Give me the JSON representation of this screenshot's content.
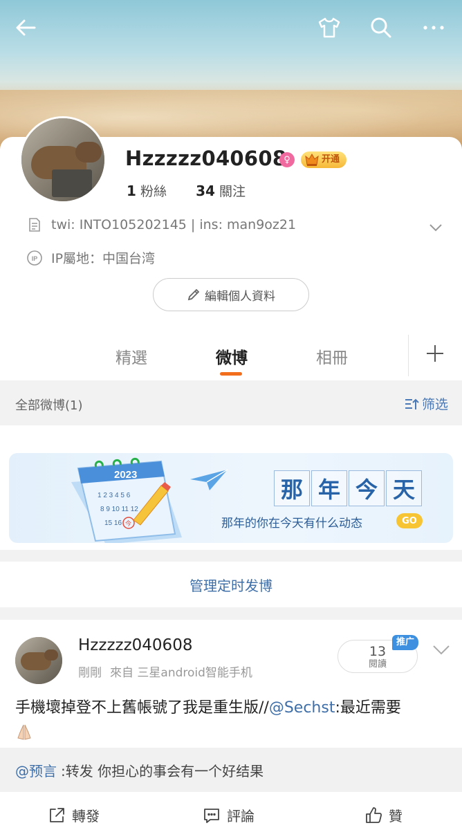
{
  "profile": {
    "username": "Hzzzzz040608",
    "gender_symbol": "♀",
    "vip_label": "开通",
    "followers_count": "1",
    "followers_label": "粉絲",
    "following_count": "34",
    "following_label": "關注",
    "bio": "twi: INTO105202145 | ins: man9oz21",
    "ip_location": "IP屬地：中国台湾",
    "edit_button": "編輯個人資料"
  },
  "tabs": [
    {
      "label": "精選",
      "active": false
    },
    {
      "label": "微博",
      "active": true
    },
    {
      "label": "相冊",
      "active": false
    }
  ],
  "filterbar": {
    "all_label": "全部微博(1)",
    "filter_label": "筛选"
  },
  "promo": {
    "title_chars": [
      "那",
      "年",
      "今",
      "天"
    ],
    "subtitle": "那年的你在今天有什么动态",
    "go_label": "GO",
    "calendar_year": "2023",
    "calendar_today": "今"
  },
  "manage_label": "管理定时发博",
  "post": {
    "author": "Hzzzzz040608",
    "time": "剛剛",
    "source": "來自 三星android智能手机",
    "read_count": "13",
    "read_label": "閱讀",
    "promo_tag": "推广",
    "text_before": "手機壞掉登不上舊帳號了我是重生版//",
    "mention": "@Sechst",
    "text_after": ":最近需要",
    "retweet_mention": "@预言",
    "retweet_text": ":转发 你担心的事会有一个好结果"
  },
  "actions": {
    "repost": "轉發",
    "comment": "評論",
    "like": "贊"
  },
  "icons": {
    "back": "back-arrow-icon",
    "shirt": "shirt-icon",
    "search": "search-icon",
    "more": "more-icon",
    "bio": "document-icon",
    "ip": "ip-icon",
    "edit": "pencil-icon",
    "add_tab": "plus-icon",
    "filter": "filter-icon",
    "post_menu": "chevron-down-icon",
    "repost": "share-icon",
    "comment": "comment-icon",
    "like": "thumbs-up-icon"
  },
  "colors": {
    "accent_orange": "#f26e1d",
    "link_blue": "#3f6fa8",
    "gender_pink": "#f06aa0",
    "vip_gold": "#f6b838"
  }
}
